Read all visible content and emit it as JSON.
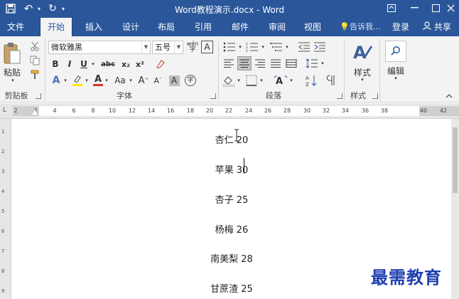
{
  "window": {
    "title": "Word教程演示.docx - Word",
    "quick_access": {
      "save": "💾",
      "undo": "↶",
      "redo": "↻"
    },
    "controls": {
      "restore": "▣",
      "minimize": "—",
      "maximize": "☐",
      "close": "✕"
    }
  },
  "tabs": [
    {
      "label": "文件"
    },
    {
      "label": "开始"
    },
    {
      "label": "插入"
    },
    {
      "label": "设计"
    },
    {
      "label": "布局"
    },
    {
      "label": "引用"
    },
    {
      "label": "邮件"
    },
    {
      "label": "审阅"
    },
    {
      "label": "视图"
    }
  ],
  "tell_me": {
    "icon": "💡",
    "text": "告诉我..."
  },
  "account": {
    "login": "登录",
    "share": "共享"
  },
  "ribbon": {
    "clipboard": {
      "paste": "粘贴",
      "label": "剪贴板"
    },
    "font": {
      "font_name": "微软雅黑",
      "font_size": "五号",
      "phonetic": "wén",
      "bold": "B",
      "italic": "I",
      "underline": "U",
      "strikethrough": "abc",
      "subscript": "x₂",
      "superscript": "x²",
      "font_color": "A",
      "change_case": "Aa",
      "grow": "A",
      "shrink": "A",
      "char_shading": "A",
      "enclose": "字",
      "label": "字体"
    },
    "paragraph": {
      "label": "段落"
    },
    "styles": {
      "button": "样式",
      "label": "样式"
    },
    "editing": {
      "button": "编辑"
    }
  },
  "ruler": {
    "corner": "L",
    "ticks": [
      "2",
      "2",
      "4",
      "6",
      "8",
      "10",
      "12",
      "14",
      "16",
      "18",
      "20",
      "22",
      "24",
      "26",
      "28",
      "30",
      "32",
      "34",
      "36",
      "38",
      "40",
      "42"
    ]
  },
  "vruler": [
    "1",
    "2",
    "3",
    "4",
    "5",
    "6",
    "7",
    "8",
    "9"
  ],
  "document": {
    "lines": [
      "杏仁 20",
      "苹果 30",
      "杏子 25",
      "杨梅 26",
      "南美梨 28",
      "甘蔗渣 25"
    ]
  },
  "watermark": "最需教育"
}
